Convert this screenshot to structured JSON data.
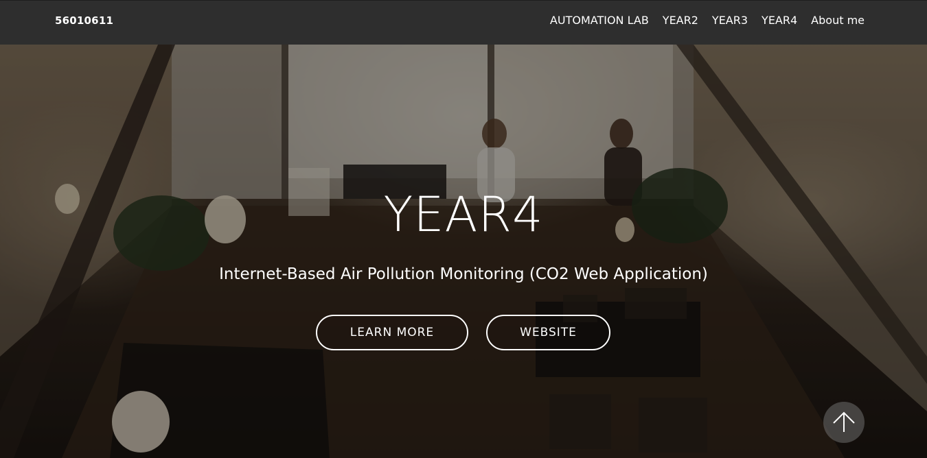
{
  "navbar": {
    "brand": "56010611",
    "links": [
      {
        "label": "AUTOMATION LAB"
      },
      {
        "label": "YEAR2"
      },
      {
        "label": "YEAR3"
      },
      {
        "label": "YEAR4"
      },
      {
        "label": "About me"
      }
    ],
    "background_color": "#2e2e2e"
  },
  "hero": {
    "title": "YEAR4",
    "subtitle": "Internet-Based Air Pollution Monitoring (CO2 Web Application)",
    "background_image": "cafe interior photo viewed from above",
    "buttons": {
      "learn_more": "LEARN MORE",
      "website": "WEBSITE"
    }
  },
  "back_to_top": {
    "icon": "arrow-up-icon"
  }
}
